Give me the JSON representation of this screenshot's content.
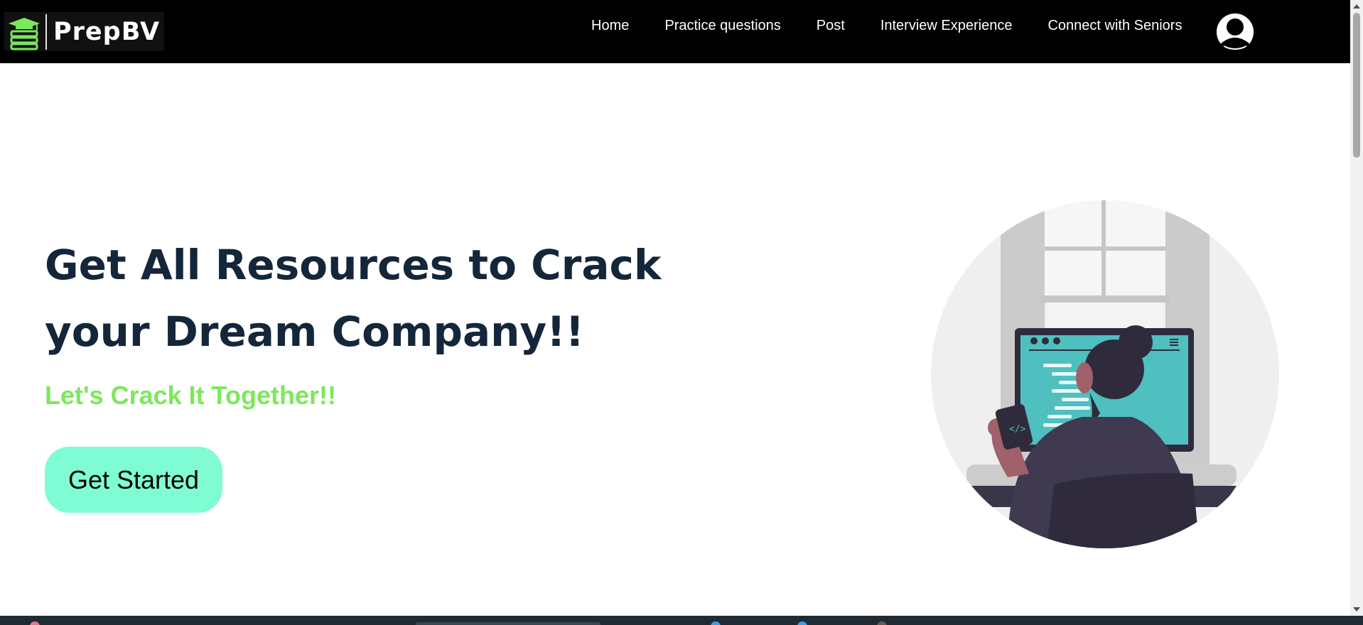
{
  "brand": {
    "name": "PrepBV",
    "accent": "#7ce85b"
  },
  "nav": {
    "items": [
      {
        "label": "Home"
      },
      {
        "label": "Practice questions"
      },
      {
        "label": "Post"
      },
      {
        "label": "Interview Experience"
      },
      {
        "label": "Connect with Seniors"
      }
    ],
    "profile_icon": "user-avatar-icon"
  },
  "hero": {
    "title": "Get All Resources to Crack your Dream Company!!",
    "subtitle": "Let's Crack It Together!!",
    "cta_label": "Get Started",
    "title_color": "#14263a",
    "subtitle_color": "#7ce85b",
    "cta_color": "#7ffcd3",
    "illustration_icon": "developer-at-computer-illustration"
  }
}
